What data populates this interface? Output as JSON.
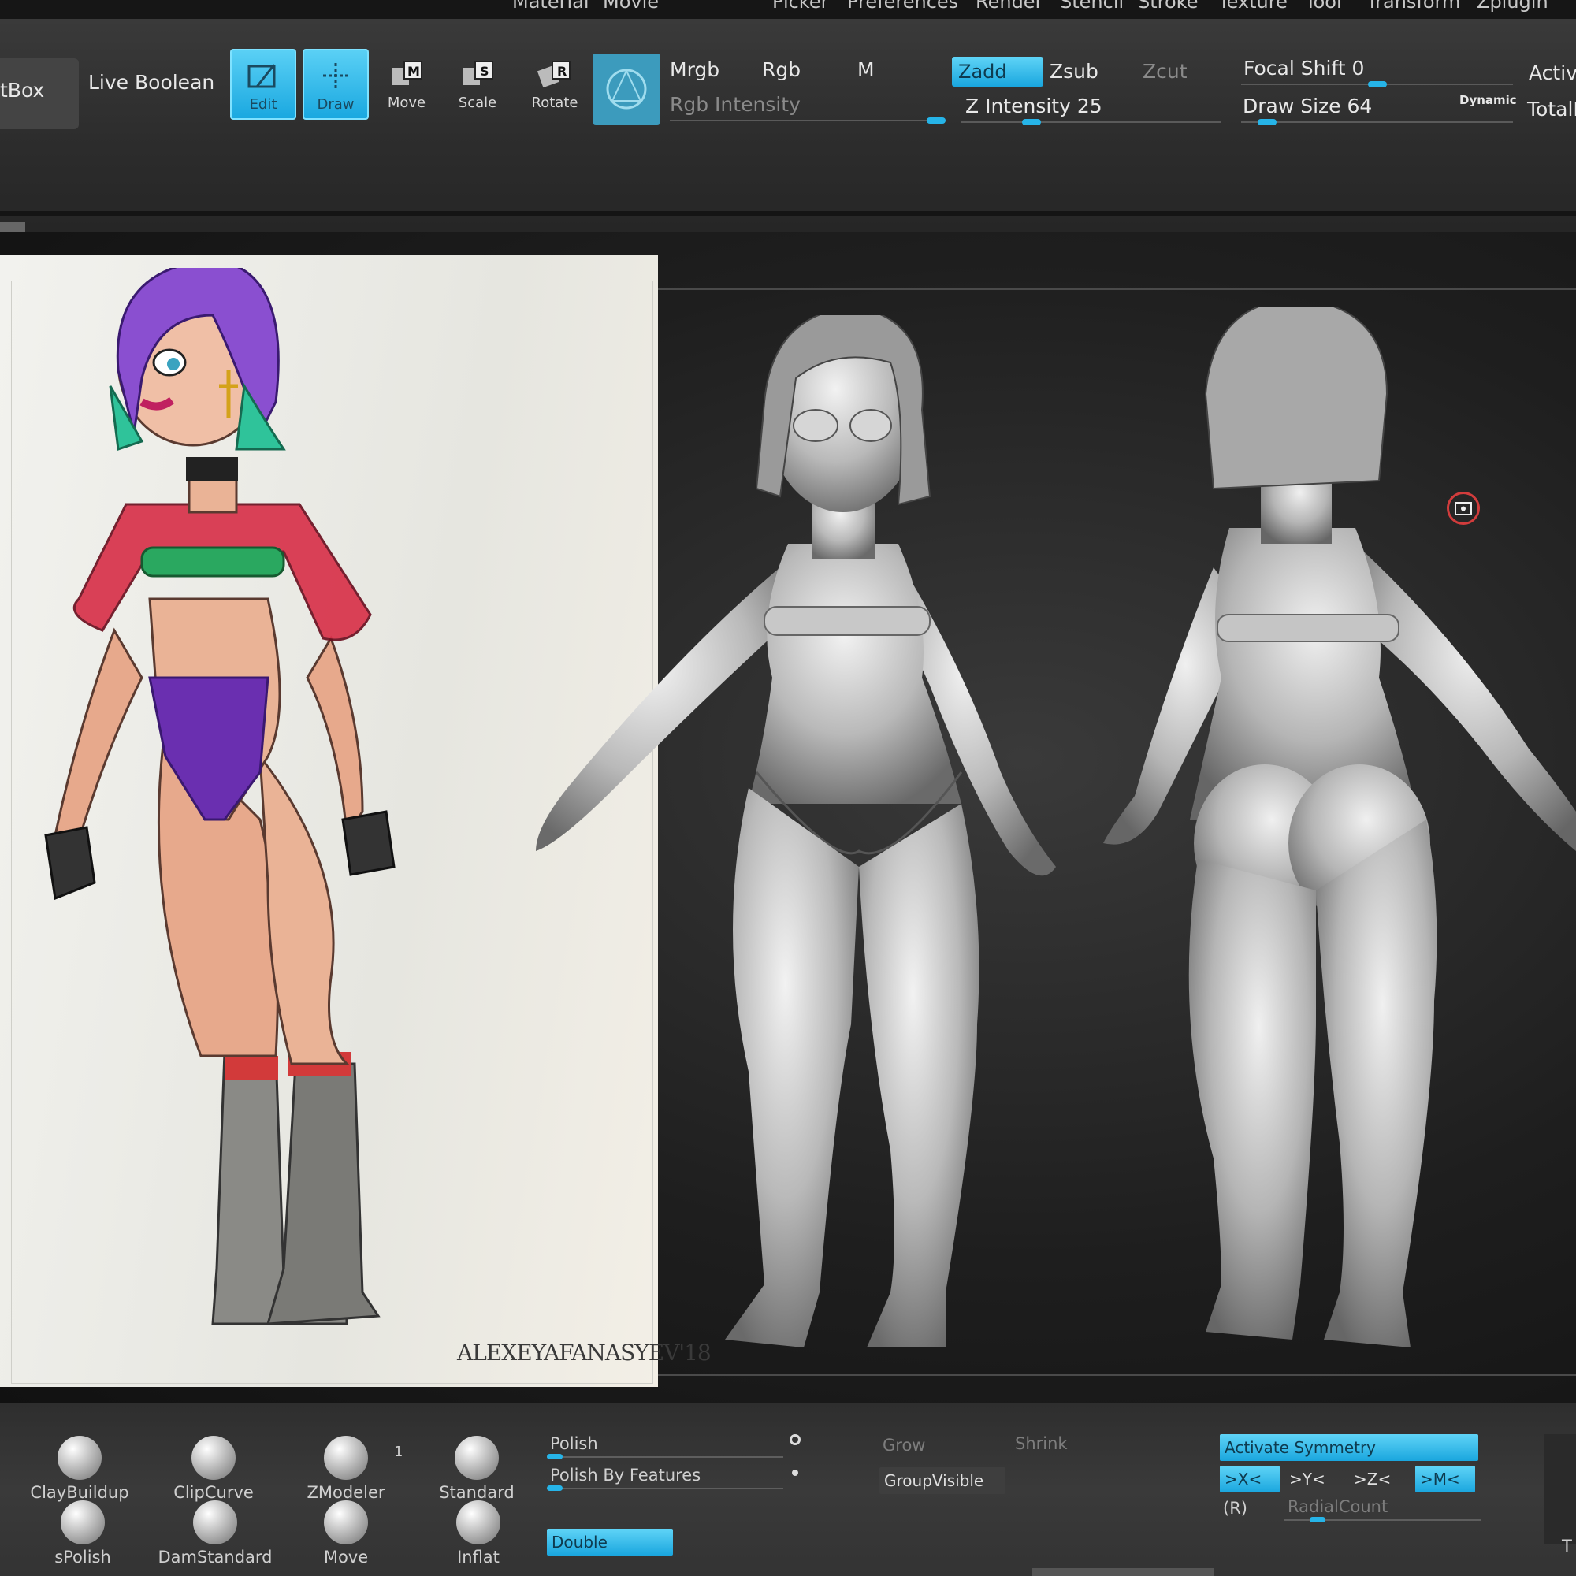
{
  "menu": {
    "items": [
      "Material",
      "Movie",
      "Picker",
      "Preferences",
      "Render",
      "Stencil",
      "Stroke",
      "Texture",
      "Tool",
      "Transform",
      "Zplugin"
    ]
  },
  "toolbar": {
    "box_label": "tBox",
    "live_boolean": "Live Boolean",
    "edit": "Edit",
    "draw": "Draw",
    "move": "Move",
    "scale": "Scale",
    "rotate": "Rotate",
    "mrgb": "Mrgb",
    "rgb": "Rgb",
    "m": "M",
    "rgb_intensity": "Rgb Intensity",
    "zadd": "Zadd",
    "zsub": "Zsub",
    "zcut": "Zcut",
    "z_intensity": "Z Intensity 25",
    "focal_shift": "Focal Shift 0",
    "draw_size": "Draw Size 64",
    "dynamic": "Dynamic",
    "active": "Active",
    "total": "TotalP",
    "z_intensity_value": 25,
    "focal_shift_value": 0,
    "draw_size_value": 64
  },
  "reference": {
    "signature": "ALEXEYAFANASYEV'18"
  },
  "tray": {
    "brushes": {
      "claybuildup": "ClayBuildup",
      "clipcurve": "ClipCurve",
      "zmodeler": "ZModeler",
      "zmodeler_count": "1",
      "standard": "Standard",
      "spolish": "sPolish",
      "damstandard": "DamStandard",
      "move": "Move",
      "inflat": "Inflat"
    },
    "polish": "Polish",
    "polish_by_features": "Polish By Features",
    "double": "Double",
    "grow": "Grow",
    "shrink": "Shrink",
    "group_visible": "GroupVisible",
    "activate_symmetry": "Activate Symmetry",
    "sym_x": ">X<",
    "sym_y": ">Y<",
    "sym_z": ">Z<",
    "sym_m": ">M<",
    "r": "(R)",
    "radial_count": "RadialCount",
    "edge_letter": "T"
  },
  "colors": {
    "accent": "#1aa8e0",
    "hair_purple": "#8a4fd0",
    "hair_teal": "#2fc39a",
    "jacket_red": "#d8324a",
    "bodysuit_purple": "#6a2fb0"
  }
}
